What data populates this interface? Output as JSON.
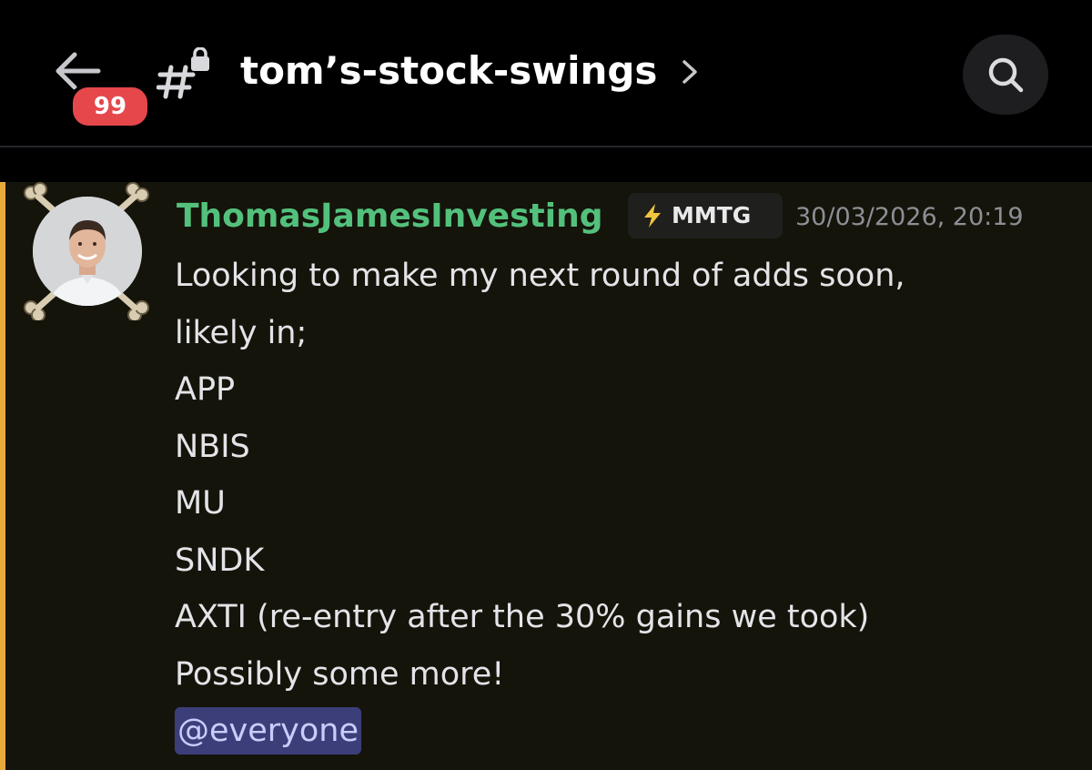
{
  "header": {
    "unread_badge": "99",
    "channel_name": "tom’s-stock-swings",
    "back_icon": "arrow-left-icon",
    "channel_icon": "locked-hash-icon",
    "chevron_icon": "chevron-right-icon",
    "search_icon": "search-icon"
  },
  "message": {
    "author": "ThomasJamesInvesting",
    "guild_tag": "MMTG",
    "guild_tag_icon": "lightning-bolt-icon",
    "timestamp": "30/03/2026, 20:19",
    "lines": [
      "Looking to make my next round of adds soon,",
      "likely in;",
      "APP",
      "NBIS",
      "MU",
      "SNDK",
      "AXTI (re-entry after the 30% gains we took)",
      "Possibly some more!"
    ],
    "mention": "@everyone"
  },
  "colors": {
    "background": "#000000",
    "message_highlight": "#15140b",
    "mention_bar": "#e8a93c",
    "author": "#53c17c",
    "badge": "#e5474b",
    "mention_bg": "#3c3e7a",
    "mention_text": "#c9cdfb"
  }
}
